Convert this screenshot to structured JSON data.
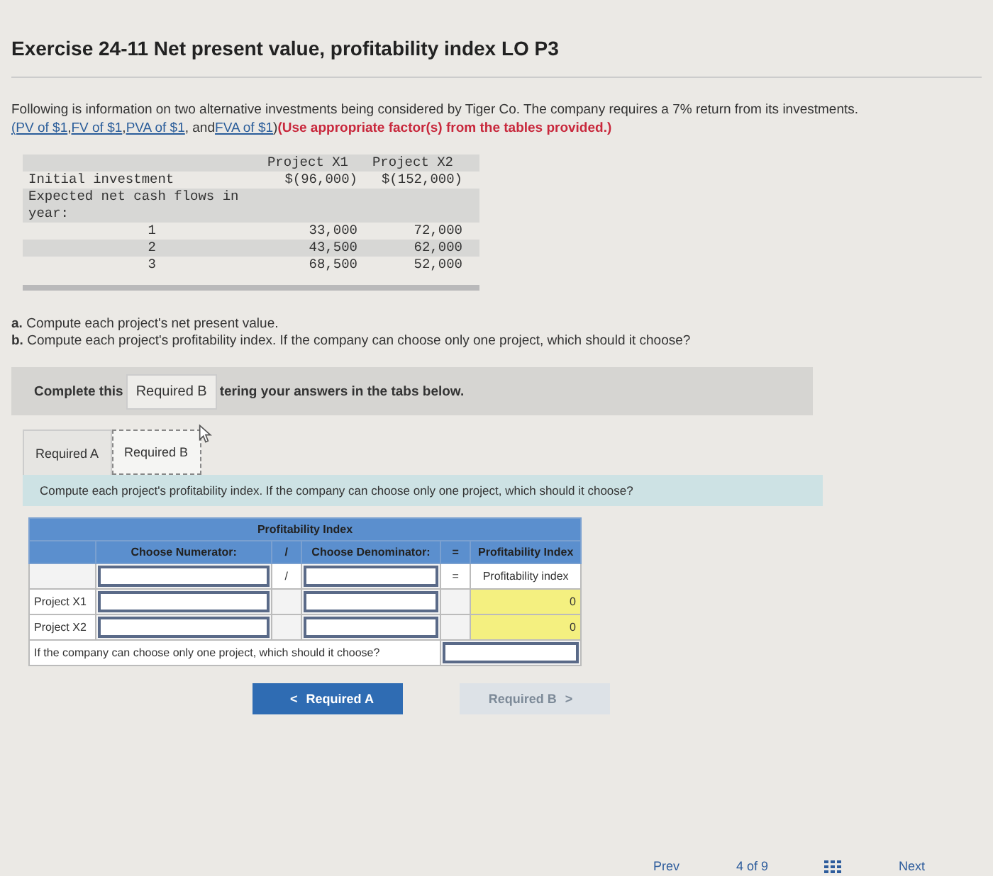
{
  "title": "Exercise 24-11 Net present value, profitability index LO P3",
  "intro": {
    "text": "Following is information on two alternative investments being considered by Tiger Co. The company requires a 7% return from its investments.",
    "links": [
      "(PV of $1",
      "FV of $1",
      "PVA of $1",
      "FVA of $1"
    ],
    "link_sep": [
      ",",
      ",",
      ", and",
      ")"
    ],
    "note": "(Use appropriate factor(s) from the tables provided.)"
  },
  "investment_table": {
    "columns": [
      "Project X1",
      "Project X2"
    ],
    "rows": [
      {
        "kind": "item",
        "label": "Initial investment",
        "values": [
          "$(96,000)",
          "$(152,000)"
        ]
      },
      {
        "kind": "item",
        "label": "Expected net cash flows in year:",
        "values": []
      },
      {
        "kind": "year",
        "label": "1",
        "values": [
          "33,000",
          "72,000"
        ]
      },
      {
        "kind": "year",
        "label": "2",
        "values": [
          "43,500",
          "62,000"
        ]
      },
      {
        "kind": "year",
        "label": "3",
        "values": [
          "68,500",
          "52,000"
        ]
      }
    ]
  },
  "questions": [
    {
      "letter": "a.",
      "text": "Compute each project's net present value."
    },
    {
      "letter": "b.",
      "text": "Compute each project's profitability index. If the company can choose only one project, which should it choose?"
    }
  ],
  "banner": {
    "left": "Complete this",
    "tooltip": "Required B",
    "right": "tering your answers in the tabs below."
  },
  "tabs": [
    {
      "label": "Required A",
      "selected": false
    },
    {
      "label": "Required B",
      "selected": true
    }
  ],
  "prompt": "Compute each project's profitability index. If the company can choose only one project, which should it choose?",
  "pi_table": {
    "title": "Profitability Index",
    "header": [
      "Choose Numerator:",
      "/",
      "Choose Denominator:",
      "=",
      "Profitability Index"
    ],
    "subheader": {
      "divide": "/",
      "equals": "=",
      "result": "Profitability index"
    },
    "rows": [
      {
        "label": "Project X1",
        "result": "0"
      },
      {
        "label": "Project X2",
        "result": "0"
      }
    ],
    "question": "If the company can choose only one project, which should it choose?"
  },
  "nav_buttons": [
    {
      "label": "Required A",
      "icon_before": "<",
      "disabled": false
    },
    {
      "label": "Required B",
      "icon_after": ">",
      "disabled": true
    }
  ],
  "pager": {
    "prev": "Prev",
    "position": "4 of 9",
    "next": "Next"
  }
}
